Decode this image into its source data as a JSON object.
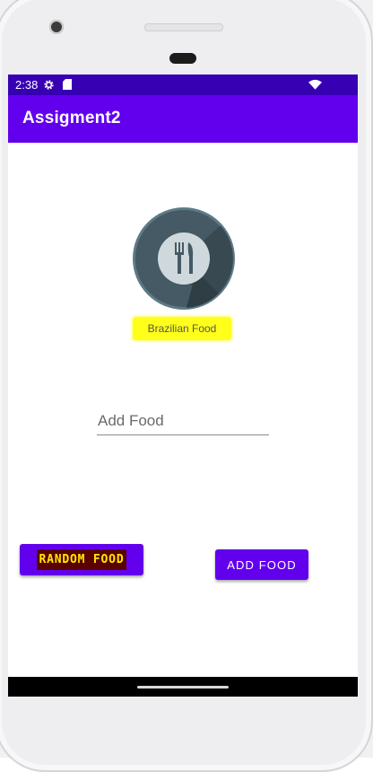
{
  "status_bar": {
    "time": "2:38",
    "icons": [
      "gear-icon",
      "sd-card-icon",
      "wifi-icon"
    ]
  },
  "app_bar": {
    "title": "Assigment2",
    "color": "#6200ee"
  },
  "food": {
    "image_icon": "fork-knife-icon",
    "name": "Brazilian Food"
  },
  "add_food_input": {
    "placeholder": "Add Food",
    "value": ""
  },
  "buttons": {
    "random_label": "RANDOM FOOD",
    "add_label": "ADD FOOD"
  },
  "colors": {
    "status_bar": "#3700b3",
    "primary": "#6200ee",
    "highlight": "#ffff1a"
  }
}
